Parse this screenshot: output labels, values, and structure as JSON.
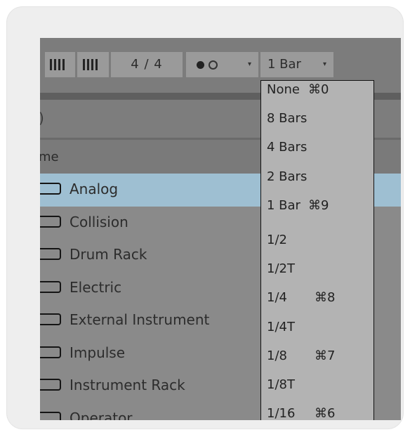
{
  "toolbar": {
    "time_signature": "4 / 4",
    "record_dropdown_arrow": "▾",
    "quantize_value": "1 Bar",
    "quantize_arrow": "▾"
  },
  "browser": {
    "top_row_text": ")",
    "column_header": "me",
    "items": [
      {
        "label": "Analog",
        "selected": true
      },
      {
        "label": "Collision",
        "selected": false
      },
      {
        "label": "Drum Rack",
        "selected": false
      },
      {
        "label": "Electric",
        "selected": false
      },
      {
        "label": "External Instrument",
        "selected": false
      },
      {
        "label": "Impulse",
        "selected": false
      },
      {
        "label": "Instrument Rack",
        "selected": false
      },
      {
        "label": "Operator",
        "selected": false
      }
    ]
  },
  "quantize_menu": {
    "items": [
      {
        "label": "None",
        "shortcut": "⌘0"
      },
      {
        "label": "8 Bars",
        "shortcut": ""
      },
      {
        "label": "4 Bars",
        "shortcut": ""
      },
      {
        "label": "2 Bars",
        "shortcut": ""
      },
      {
        "label": "1 Bar",
        "shortcut": "⌘9"
      },
      {
        "label": "1/2",
        "shortcut": ""
      },
      {
        "label": "1/2T",
        "shortcut": ""
      },
      {
        "label": "1/4",
        "shortcut": "⌘8"
      },
      {
        "label": "1/4T",
        "shortcut": ""
      },
      {
        "label": "1/8",
        "shortcut": "⌘7"
      },
      {
        "label": "1/8T",
        "shortcut": ""
      },
      {
        "label": "1/16",
        "shortcut": "⌘6"
      }
    ]
  },
  "colors": {
    "selection": "#9ebfd2",
    "menu_background": "#b3b3b3"
  }
}
